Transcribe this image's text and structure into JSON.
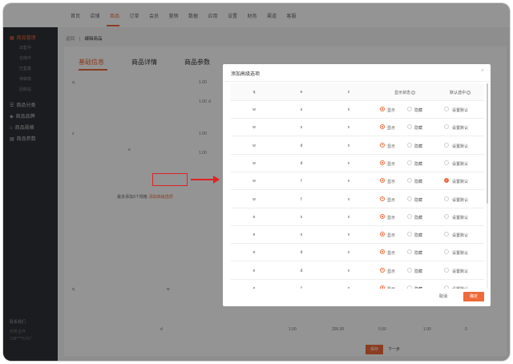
{
  "topnav": {
    "items": [
      "首页",
      "店铺",
      "商品",
      "订单",
      "会员",
      "营销",
      "数据",
      "应用",
      "设置",
      "财务",
      "渠道",
      "客服"
    ],
    "active_index": 2
  },
  "sidebar": {
    "items": [
      {
        "label": "商品管理",
        "icon": "grid-icon",
        "active": true
      },
      {
        "label": "商品分类",
        "icon": "list-icon",
        "active": false
      },
      {
        "label": "商品品牌",
        "icon": "tag-icon",
        "active": false
      },
      {
        "label": "商品规格",
        "icon": "home-icon",
        "active": false
      },
      {
        "label": "商品参数",
        "icon": "file-icon",
        "active": false
      }
    ],
    "subitems": [
      "出售中",
      "仓库中",
      "已售罄",
      "待审核",
      "回收站"
    ],
    "footer": {
      "title": "联系我们",
      "line1": "商务合作",
      "line2": "138****6707"
    }
  },
  "breadcrumb": {
    "back": "返回",
    "current": "编辑商品"
  },
  "tabs": [
    "基础信息",
    "商品详情",
    "商品参数"
  ],
  "background_form": {
    "hint": "最多添加3个规格",
    "hint_link": "添加高级选项",
    "ghost_values": [
      "q",
      "1.00",
      "1.00",
      "d",
      "z",
      "1.00",
      "1.00",
      "e",
      "q",
      "w",
      "d",
      "1.00",
      "200.00",
      "0.00",
      "1.00",
      "0"
    ],
    "save": "保存",
    "next": "下一步"
  },
  "modal": {
    "title": "添加高级选项",
    "close": "×",
    "columns": {
      "q": "q",
      "e": "e",
      "z": "z",
      "status": "显示状态",
      "default": "默认选中"
    },
    "show_label": "显示",
    "hide_label": "隐藏",
    "set_default_label": "设置默认",
    "rows": [
      {
        "q": "w",
        "e": "s",
        "z": "x",
        "show": true,
        "default": false
      },
      {
        "q": "w",
        "e": "s",
        "z": "v",
        "show": true,
        "default": false
      },
      {
        "q": "w",
        "e": "d",
        "z": "x",
        "show": true,
        "default": false
      },
      {
        "q": "w",
        "e": "d",
        "z": "v",
        "show": true,
        "default": false
      },
      {
        "q": "w",
        "e": "f",
        "z": "x",
        "show": true,
        "default": true
      },
      {
        "q": "w",
        "e": "f",
        "z": "v",
        "show": true,
        "default": false
      },
      {
        "q": "e",
        "e": "s",
        "z": "x",
        "show": true,
        "default": false
      },
      {
        "q": "e",
        "e": "s",
        "z": "v",
        "show": true,
        "default": false
      },
      {
        "q": "e",
        "e": "d",
        "z": "x",
        "show": true,
        "default": false
      },
      {
        "q": "e",
        "e": "d",
        "z": "v",
        "show": true,
        "default": false
      },
      {
        "q": "e",
        "e": "f",
        "z": "x",
        "show": true,
        "default": false
      }
    ],
    "cancel": "取消",
    "confirm": "确定"
  },
  "colors": {
    "accent": "#ef6a3a",
    "sidebar": "#2f3136",
    "annotation": "#e02222"
  }
}
